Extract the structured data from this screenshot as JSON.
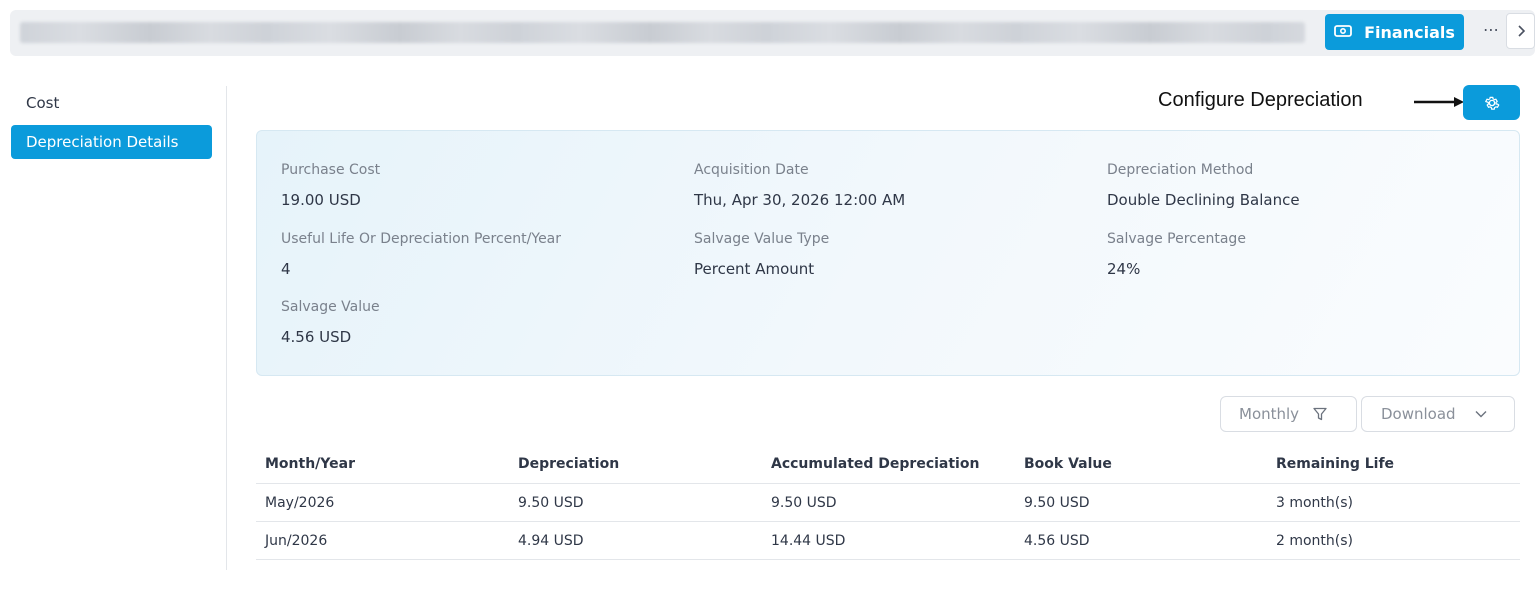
{
  "header": {
    "financials_label": "Financials",
    "more_label": "⋯",
    "next_label": "›"
  },
  "sidebar": {
    "items": [
      {
        "label": "Cost",
        "active": false
      },
      {
        "label": "Depreciation Details",
        "active": true
      }
    ]
  },
  "configure": {
    "label": "Configure Depreciation",
    "button_icon": "gear-icon"
  },
  "details": {
    "purchase_cost": {
      "label": "Purchase Cost",
      "value": "19.00 USD"
    },
    "acquisition_date": {
      "label": "Acquisition Date",
      "value": "Thu, Apr 30, 2026 12:00 AM"
    },
    "depreciation_method": {
      "label": "Depreciation Method",
      "value": "Double Declining Balance"
    },
    "useful_life": {
      "label": "Useful Life Or Depreciation Percent/Year",
      "value": "4"
    },
    "salvage_value_type": {
      "label": "Salvage Value Type",
      "value": "Percent Amount"
    },
    "salvage_percentage": {
      "label": "Salvage Percentage",
      "value": "24%"
    },
    "salvage_value": {
      "label": "Salvage Value",
      "value": "4.56 USD"
    }
  },
  "toolbar": {
    "filter_label": "Monthly",
    "download_label": "Download"
  },
  "table": {
    "columns": [
      "Month/Year",
      "Depreciation",
      "Accumulated Depreciation",
      "Book Value",
      "Remaining Life"
    ],
    "rows": [
      [
        "May/2026",
        "9.50 USD",
        "9.50 USD",
        "9.50 USD",
        "3 month(s)"
      ],
      [
        "Jun/2026",
        "4.94 USD",
        "14.44 USD",
        "4.56 USD",
        "2 month(s)"
      ]
    ]
  },
  "colors": {
    "accent": "#0b9bdb",
    "card_bg": "#eaf5fb",
    "divider": "#e3e6ea"
  }
}
